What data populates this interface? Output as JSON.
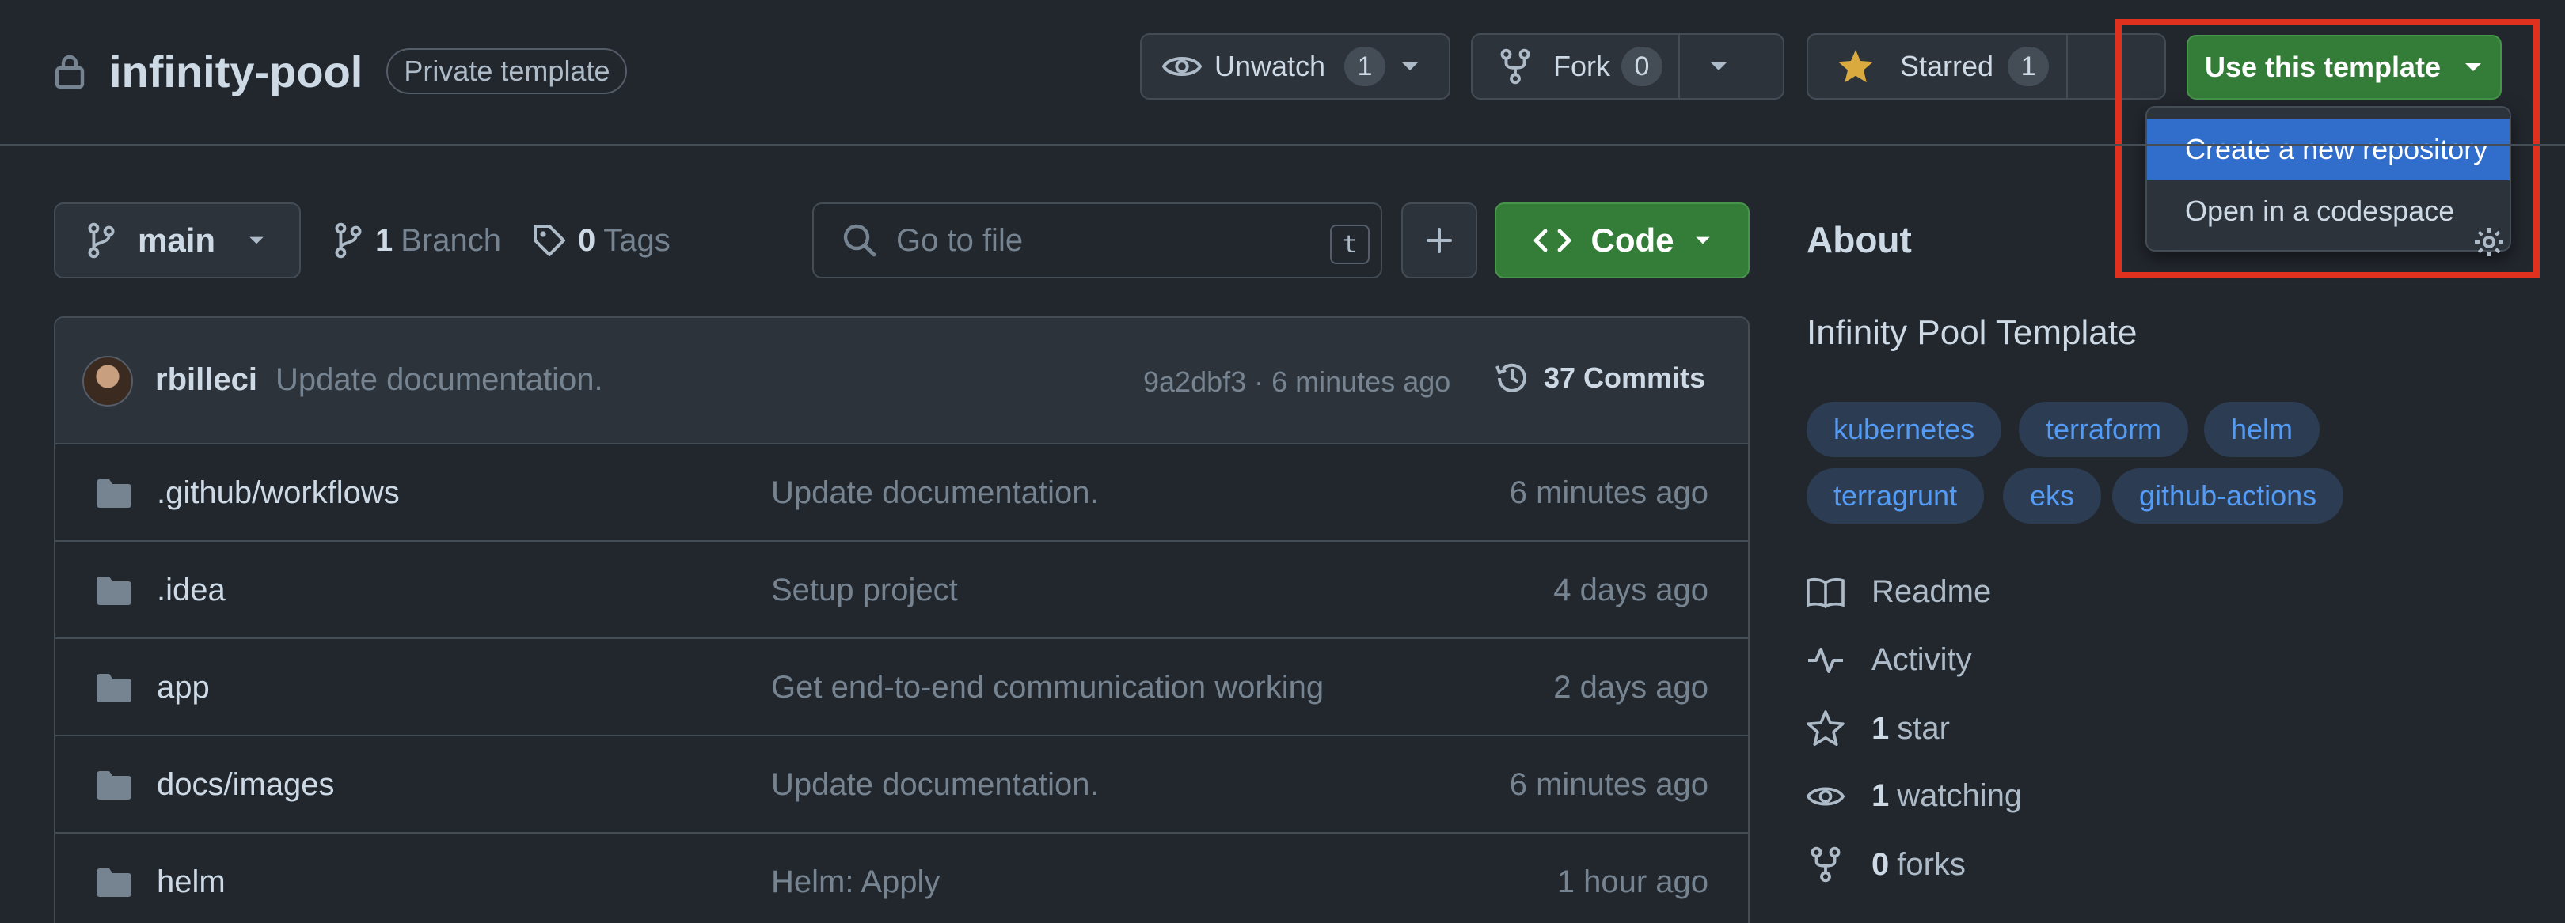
{
  "repo": {
    "name": "infinity-pool",
    "visibility_badge": "Private template"
  },
  "actions": {
    "watch": {
      "label": "Unwatch",
      "count": "1"
    },
    "fork": {
      "label": "Fork",
      "count": "0"
    },
    "star": {
      "label": "Starred",
      "count": "1"
    },
    "use_template": {
      "label": "Use this template"
    }
  },
  "template_menu": {
    "items": [
      "Create a new repository",
      "Open in a codespace"
    ]
  },
  "toolbar": {
    "branch": "main",
    "branches": {
      "count": "1",
      "label": "Branch"
    },
    "tags": {
      "count": "0",
      "label": "Tags"
    },
    "search_placeholder": "Go to file",
    "search_shortcut": "t",
    "code_label": "Code"
  },
  "latest_commit": {
    "author": "rbilleci",
    "message": "Update documentation.",
    "sha_time": "9a2dbf3 · 6 minutes ago",
    "commits": "37 Commits"
  },
  "files": [
    {
      "name": ".github/workflows",
      "message": "Update documentation.",
      "time": "6 minutes ago"
    },
    {
      "name": ".idea",
      "message": "Setup project",
      "time": "4 days ago"
    },
    {
      "name": "app",
      "message": "Get end-to-end communication working",
      "time": "2 days ago"
    },
    {
      "name": "docs/images",
      "message": "Update documentation.",
      "time": "6 minutes ago"
    },
    {
      "name": "helm",
      "message": "Helm: Apply",
      "time": "1 hour ago"
    }
  ],
  "about": {
    "title": "About",
    "description": "Infinity Pool Template",
    "topics": [
      "kubernetes",
      "terraform",
      "helm",
      "terragrunt",
      "eks",
      "github-actions"
    ],
    "readme": "Readme",
    "activity": "Activity",
    "stars": {
      "count": "1",
      "label": "star"
    },
    "watching": {
      "count": "1",
      "label": "watching"
    },
    "forks": {
      "count": "0",
      "label": "forks"
    }
  },
  "colors": {
    "background": "#22272e",
    "primary_button": "#347d39",
    "menu_highlight": "#316dca",
    "annotation_box": "#e0301e",
    "topic_text": "#539bf5"
  }
}
